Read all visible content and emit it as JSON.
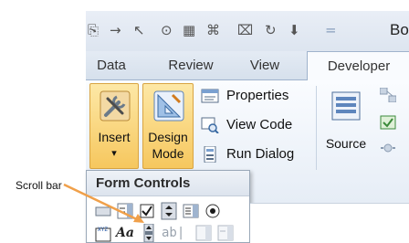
{
  "quick_access": {
    "items": [
      "⎘",
      "→",
      "↖",
      "⊙",
      "▦",
      "⌘",
      "⌧",
      "↻",
      "⬇",
      "="
    ],
    "title_fragment": "Bo"
  },
  "tabs": [
    {
      "label": "Data",
      "active": false
    },
    {
      "label": "Review",
      "active": false
    },
    {
      "label": "View",
      "active": false
    },
    {
      "label": "Developer",
      "active": true
    }
  ],
  "ribbon": {
    "insert_label": "Insert",
    "insert_arrow": "▾",
    "design_mode_label_1": "Design",
    "design_mode_label_2": "Mode",
    "properties_label": "Properties",
    "view_code_label": "View Code",
    "run_dialog_label": "Run Dialog",
    "source_label": "Source"
  },
  "dropdown": {
    "header": "Form Controls",
    "label_control_text": "ab|",
    "text_style_glyph": "Aa"
  },
  "callout": {
    "label": "Scroll bar"
  },
  "colors": {
    "hover_top": "#fde8a6",
    "hover_bottom": "#f6c75e",
    "arrow": "#f0a04a",
    "ribbon_bg": "#f3f7fc"
  }
}
